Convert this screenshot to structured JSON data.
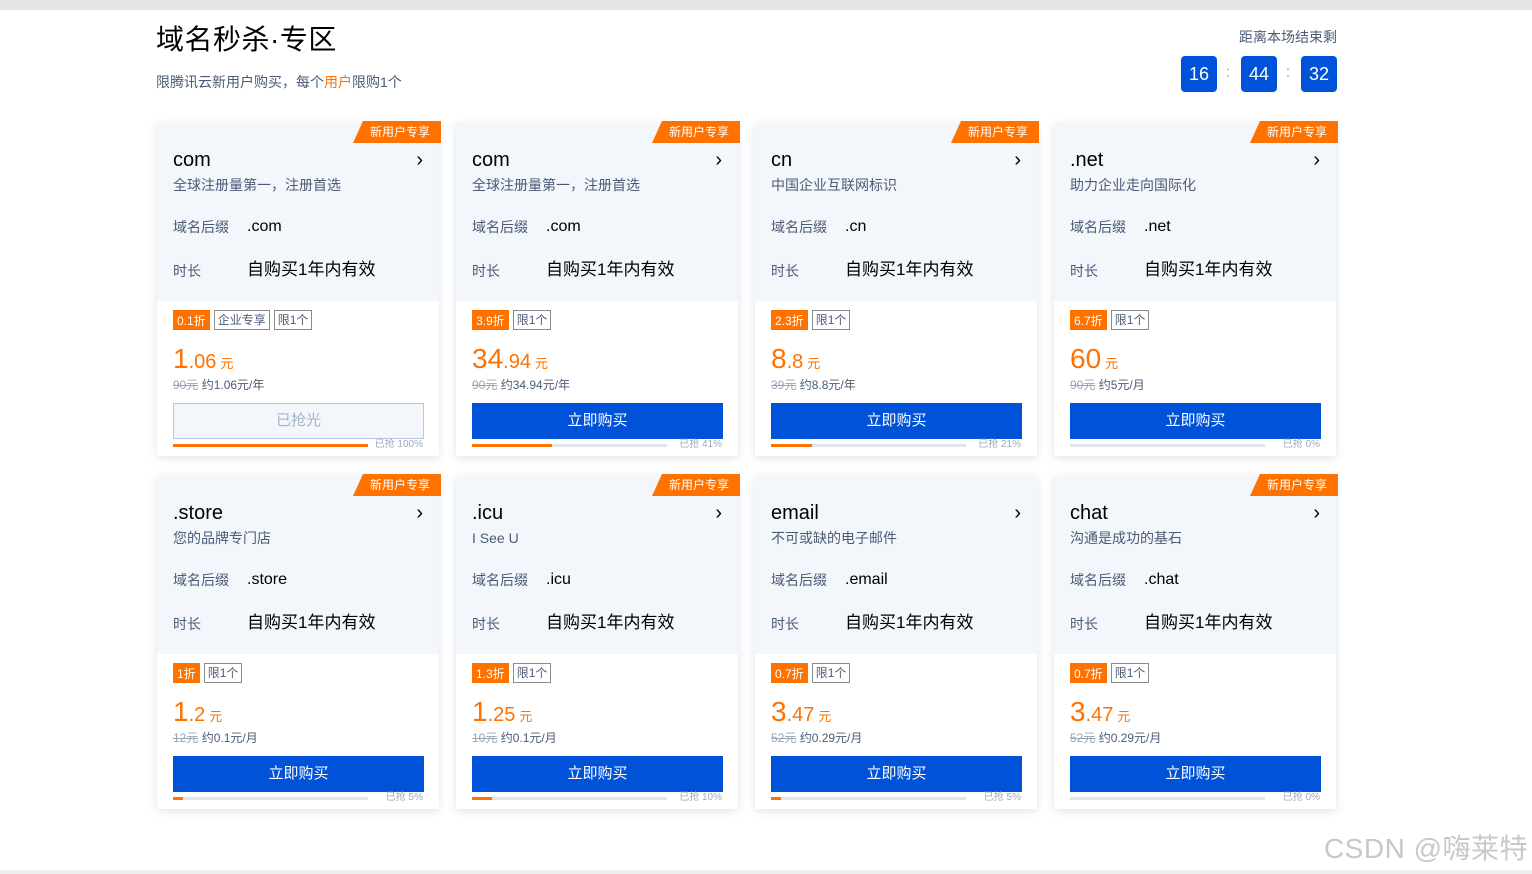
{
  "header": {
    "title": "域名秒杀·专区",
    "subtitle_pre": "限腾讯云新用户购买，每个",
    "subtitle_hl": "用户",
    "subtitle_post": "限购1个",
    "countdown_label": "距离本场结束剩",
    "hours": "16",
    "minutes": "44",
    "seconds": "32",
    "sep": ":"
  },
  "labels": {
    "suffix": "域名后缀",
    "duration": "时长",
    "unit": "元"
  },
  "cards": [
    {
      "badge": "新用户专享",
      "name": "com",
      "desc": "全球注册量第一，注册首选",
      "suffix": ".com",
      "duration": "自购买1年内有效",
      "discount": "0.1折",
      "tags": [
        "企业专享",
        "限1个"
      ],
      "price_int": "1",
      "price_dec": ".06",
      "orig": "90元",
      "per": "约1.06元/年",
      "btn": "已抢光",
      "disabled": true,
      "progress": 1.0,
      "sold": "已抢 100%"
    },
    {
      "badge": "新用户专享",
      "name": "com",
      "desc": "全球注册量第一，注册首选",
      "suffix": ".com",
      "duration": "自购买1年内有效",
      "discount": "3.9折",
      "tags": [
        "限1个"
      ],
      "price_int": "34",
      "price_dec": ".94",
      "orig": "90元",
      "per": "约34.94元/年",
      "btn": "立即购买",
      "disabled": false,
      "progress": 0.41,
      "sold": "已抢 41%"
    },
    {
      "badge": "新用户专享",
      "name": "cn",
      "desc": "中国企业互联网标识",
      "suffix": ".cn",
      "duration": "自购买1年内有效",
      "discount": "2.3折",
      "tags": [
        "限1个"
      ],
      "price_int": "8",
      "price_dec": ".8",
      "orig": "39元",
      "per": "约8.8元/年",
      "btn": "立即购买",
      "disabled": false,
      "progress": 0.21,
      "sold": "已抢 21%"
    },
    {
      "badge": "新用户专享",
      "name": ".net",
      "desc": "助力企业走向国际化",
      "suffix": ".net",
      "duration": "自购买1年内有效",
      "discount": "6.7折",
      "tags": [
        "限1个"
      ],
      "price_int": "60",
      "price_dec": "",
      "orig": "90元",
      "per": "约5元/月",
      "btn": "立即购买",
      "disabled": false,
      "progress": 0,
      "sold": "已抢 0%"
    },
    {
      "badge": "新用户专享",
      "name": ".store",
      "desc": "您的品牌专门店",
      "suffix": ".store",
      "duration": "自购买1年内有效",
      "discount": "1折",
      "tags": [
        "限1个"
      ],
      "price_int": "1",
      "price_dec": ".2",
      "orig": "12元",
      "per": "约0.1元/月",
      "btn": "立即购买",
      "disabled": false,
      "progress": 0.05,
      "sold": "已抢 5%"
    },
    {
      "badge": "新用户专享",
      "name": ".icu",
      "desc": "I See U",
      "suffix": ".icu",
      "duration": "自购买1年内有效",
      "discount": "1.3折",
      "tags": [
        "限1个"
      ],
      "price_int": "1",
      "price_dec": ".25",
      "orig": "10元",
      "per": "约0.1元/月",
      "btn": "立即购买",
      "disabled": false,
      "progress": 0.1,
      "sold": "已抢 10%"
    },
    {
      "badge": "",
      "name": "email",
      "desc": "不可或缺的电子邮件",
      "suffix": ".email",
      "duration": "自购买1年内有效",
      "discount": "0.7折",
      "tags": [
        "限1个"
      ],
      "price_int": "3",
      "price_dec": ".47",
      "orig": "52元",
      "per": "约0.29元/月",
      "btn": "立即购买",
      "disabled": false,
      "progress": 0.05,
      "sold": "已抢 5%"
    },
    {
      "badge": "新用户专享",
      "name": "chat",
      "desc": "沟通是成功的基石",
      "suffix": ".chat",
      "duration": "自购买1年内有效",
      "discount": "0.7折",
      "tags": [
        "限1个"
      ],
      "price_int": "3",
      "price_dec": ".47",
      "orig": "52元",
      "per": "约0.29元/月",
      "btn": "立即购买",
      "disabled": false,
      "progress": 0,
      "sold": "已抢 0%"
    }
  ],
  "watermark": "CSDN @嗨莱特",
  "colors": {
    "accent": "#0052d9",
    "orange": "#ff7200",
    "card_top": "#f3f6fb"
  }
}
